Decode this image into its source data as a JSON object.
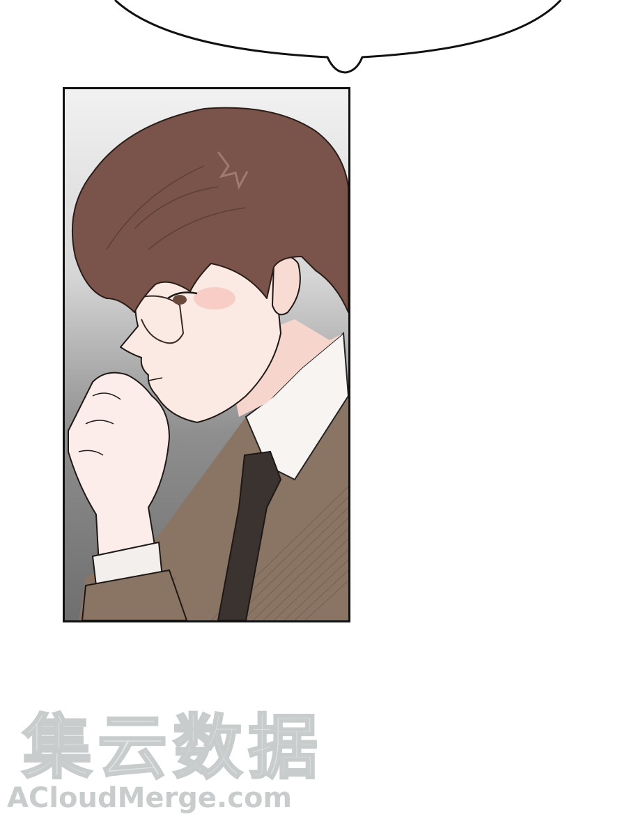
{
  "colors": {
    "background": "#ffffff",
    "panel_border": "#111111",
    "hair": "#7a544a",
    "skin": "#fbe9e3",
    "suit": "#8a7565",
    "tie": "#3b3330",
    "watermark": "#dfe3e3"
  },
  "watermark": {
    "cjk": "集云数据",
    "latin": "ACloudMerge.com"
  }
}
